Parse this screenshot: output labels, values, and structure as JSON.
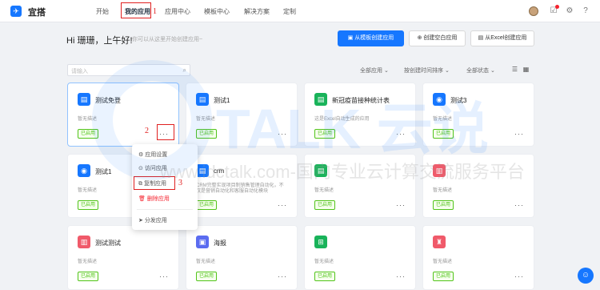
{
  "brand": "宜搭",
  "nav": [
    "开始",
    "我的应用",
    "应用中心",
    "模板中心",
    "解决方案",
    "定制"
  ],
  "hero": {
    "greeting": "Hi 珊珊，上午好!",
    "hint": "你可以从这里开始创建应用~",
    "btn_template": "从模板创建应用",
    "btn_blank": "创建空白应用",
    "btn_excel": "从Excel创建应用"
  },
  "search_placeholder": "请输入",
  "filters": {
    "all": "全部应用 ⌄",
    "sort": "按创建时间排序 ⌄",
    "status": "全部状态 ⌄"
  },
  "cards": [
    {
      "name": "测试免登",
      "desc": "暂无描述",
      "tag": "已启用",
      "color": "#1677ff",
      "icon": "▤"
    },
    {
      "name": "测试1",
      "desc": "暂无描述",
      "tag": "已启用",
      "color": "#1677ff",
      "icon": "▤"
    },
    {
      "name": "新冠疫苗接种统计表",
      "desc": "这是Excel自动生成的应用",
      "tag": "已启用",
      "color": "#19b35a",
      "icon": "▤"
    },
    {
      "name": "测试3",
      "desc": "暂无描述",
      "tag": "已启用",
      "color": "#1677ff",
      "icon": "◉"
    },
    {
      "name": "测试1",
      "desc": "暂无描述",
      "tag": "已启用",
      "color": "#1677ff",
      "icon": "◉"
    },
    {
      "name": "crm",
      "desc": "CRM完整实现项目制销售管理自动化，不",
      "desc2": "仅是营销自动化和客服自动化模块",
      "tag": "已启用",
      "color": "#1677ff",
      "icon": "▤"
    },
    {
      "name": "",
      "desc": "暂无描述",
      "tag": "已启用",
      "color": "#19b35a",
      "icon": "▤"
    },
    {
      "name": "",
      "desc": "暂无描述",
      "tag": "已启用",
      "color": "#f05a6a",
      "icon": "▥"
    },
    {
      "name": "测试测试",
      "desc": "暂无描述",
      "tag": "已启用",
      "color": "#f05a6a",
      "icon": "▥"
    },
    {
      "name": "海报",
      "desc": "暂无描述",
      "tag": "已启用",
      "color": "#5b6cf0",
      "icon": "▣"
    },
    {
      "name": "",
      "desc": "暂无描述",
      "tag": "已启用",
      "color": "#19b35a",
      "icon": "⊞"
    },
    {
      "name": "",
      "desc": "暂无描述",
      "tag": "已启用",
      "color": "#f05a6a",
      "icon": "♜"
    }
  ],
  "more": "···",
  "menu": {
    "settings": "应用设置",
    "visit": "访问应用",
    "copy": "复制应用",
    "delete": "删除应用",
    "share": "分发应用"
  },
  "annotations": [
    "1",
    "2",
    "3"
  ],
  "watermark": {
    "logo_text": "TALK 云说",
    "url": "www.idctalk.com-国内专业云计算交流服务平台"
  }
}
